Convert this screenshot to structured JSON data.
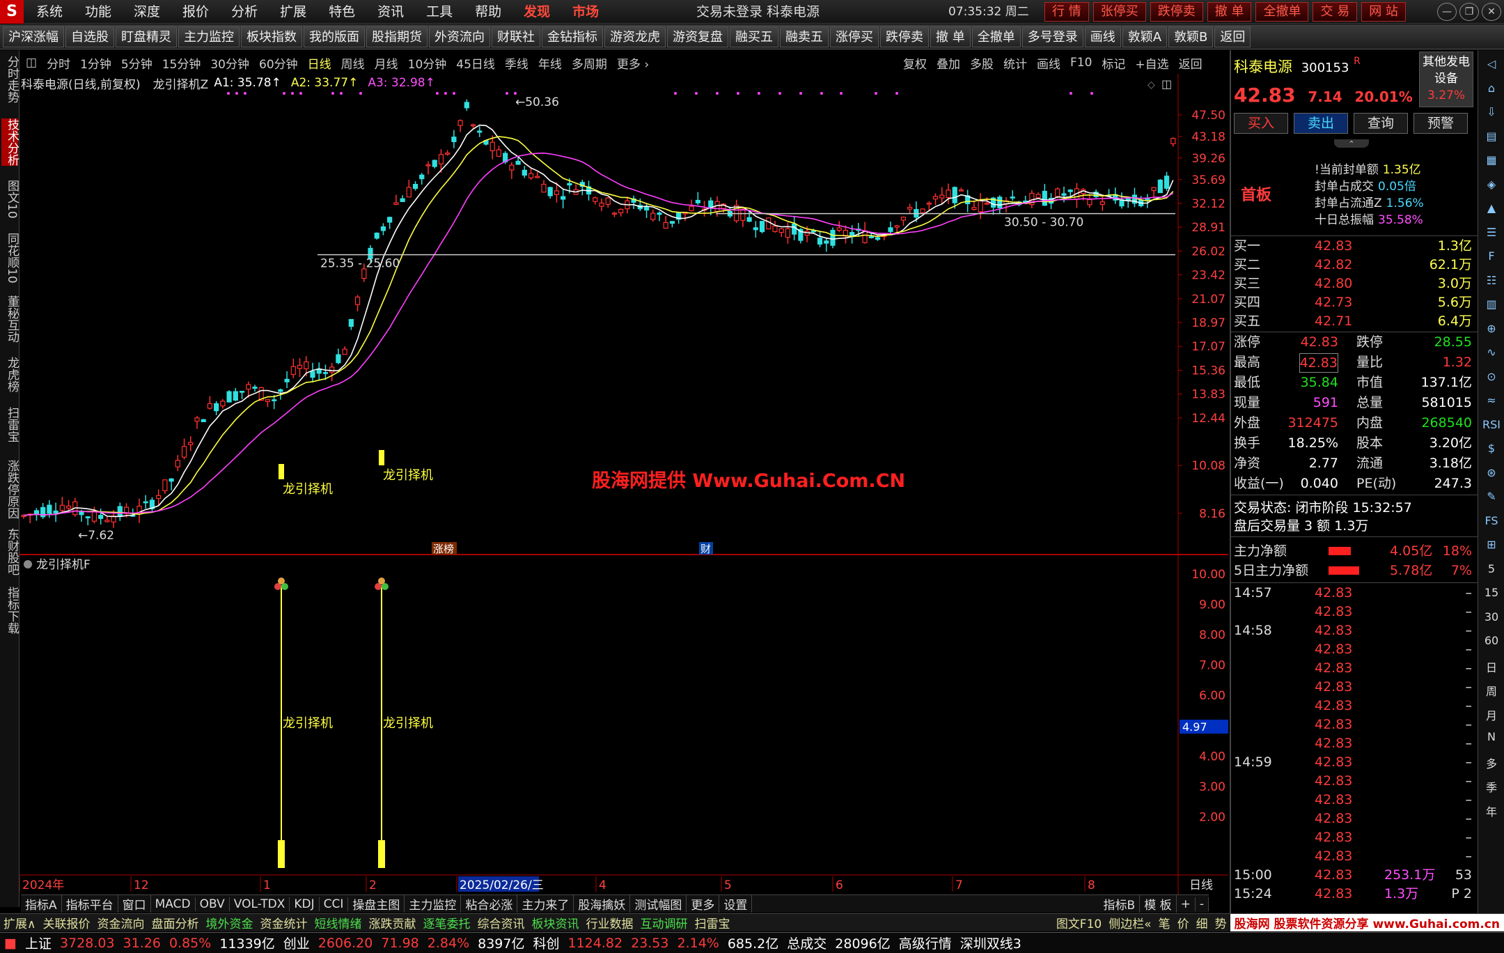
{
  "app": {
    "logo": "S",
    "menu": [
      "系统",
      "功能",
      "深度",
      "报价",
      "分析",
      "扩展",
      "特色",
      "资讯",
      "工具",
      "帮助"
    ],
    "menu_highlight": [
      "发现",
      "市场"
    ],
    "title": "交易未登录  科泰电源",
    "clock": "07:35:32 周二",
    "quick": [
      "行 情",
      "张停买",
      "跌停卖",
      "撤 单",
      "全撤单",
      "交 易",
      "网 站"
    ],
    "win": [
      "—",
      "❐",
      "✕"
    ]
  },
  "toolbar": [
    "沪深涨幅",
    "自选股",
    "盯盘精灵",
    "主力监控",
    "板块指数",
    "我的版面",
    "股指期货",
    "外资流向",
    "财联社",
    "金钻指标",
    "游资龙虎",
    "游资复盘",
    "融买五",
    "融卖五",
    "涨停买",
    "跌停卖",
    "撤 单",
    "全撤单",
    "多号登录",
    "画线",
    "敦颖A",
    "敦颖B",
    "返回"
  ],
  "left_tabs": [
    "分时走势",
    "技术分析",
    "图文10",
    "同花顺10",
    "董秘互动",
    "龙虎榜",
    "扫雷宝",
    "涨跌停原因",
    "东财股吧",
    "指标下载"
  ],
  "periods": [
    "分时",
    "1分钟",
    "5分钟",
    "15分钟",
    "30分钟",
    "60分钟",
    "日线",
    "周线",
    "月线",
    "10分钟",
    "45日线",
    "季线",
    "年线",
    "多周期",
    "更多 ›"
  ],
  "period_active": "日线",
  "chart_tools": [
    "复权",
    "叠加",
    "多股",
    "统计",
    "画线",
    "F10",
    "标记",
    "+自选",
    "返回"
  ],
  "legend": {
    "name": "科泰电源(日线,前复权)",
    "indicator": "龙引择机Z",
    "a1": "A1: 35.78↑",
    "a2": "A2: 33.77↑",
    "a3": "A3: 32.98↑"
  },
  "annotations": {
    "high": "50.36",
    "low": "7.62",
    "band1": "25.35 - 25.60",
    "band2": "30.50 - 30.70",
    "signal": "龙引择机",
    "tag_zb": "涨榜",
    "tag_cai": "财"
  },
  "price_axis": [
    "47.50",
    "43.18",
    "39.26",
    "35.69",
    "32.12",
    "28.91",
    "26.02",
    "23.42",
    "21.07",
    "18.97",
    "17.07",
    "15.36",
    "13.83",
    "12.44",
    "10.08",
    "8.16"
  ],
  "sub_legend": "龙引择机F",
  "sub_axis": [
    "10.00",
    "9.00",
    "8.00",
    "7.00",
    "6.00",
    "5.00",
    "4.00",
    "3.00",
    "2.00"
  ],
  "sub_current": "4.97",
  "date_axis": [
    "2024年",
    "12",
    "1",
    "2",
    "2025/02/26/三",
    "4",
    "5",
    "6",
    "7",
    "8"
  ],
  "date_right": "日线",
  "watermark": "股海网提供 Www.Guhai.Com.CN",
  "stock": {
    "name": "科泰电源",
    "code": "300153",
    "badge": "R",
    "price": "42.83",
    "change": "7.14",
    "pct": "20.01%",
    "other_label": "其他发电设备",
    "other_pct": "3.27%",
    "buttons": [
      "买入",
      "卖出",
      "查询",
      "预警"
    ],
    "board": "首板",
    "seal": [
      {
        "k": "!当前封单额",
        "v": "1.35亿"
      },
      {
        "k": "封单占成交",
        "v": "0.05倍"
      },
      {
        "k": "封单占流通Z",
        "v": "1.56%"
      },
      {
        "k": "十日总振幅",
        "v": "35.58%"
      }
    ],
    "bids": [
      {
        "k": "买一",
        "p": "42.83",
        "v": "1.3亿"
      },
      {
        "k": "买二",
        "p": "42.82",
        "v": "62.1万"
      },
      {
        "k": "买三",
        "p": "42.80",
        "v": "3.0万"
      },
      {
        "k": "买四",
        "p": "42.73",
        "v": "5.6万"
      },
      {
        "k": "买五",
        "p": "42.71",
        "v": "6.4万"
      }
    ],
    "stats": [
      {
        "k1": "涨停",
        "v1": "42.83",
        "k2": "跌停",
        "v2": "28.55"
      },
      {
        "k1": "最高",
        "v1": "42.83",
        "k2": "量比",
        "v2": "1.32"
      },
      {
        "k1": "最低",
        "v1": "35.84",
        "k2": "市值",
        "v2": "137.1亿"
      },
      {
        "k1": "现量",
        "v1": "591",
        "k2": "总量",
        "v2": "581015"
      },
      {
        "k1": "外盘",
        "v1": "312475",
        "k2": "内盘",
        "v2": "268540"
      },
      {
        "k1": "换手",
        "v1": "18.25%",
        "k2": "股本",
        "v2": "3.20亿"
      },
      {
        "k1": "净资",
        "v1": "2.77",
        "k2": "流通",
        "v2": "3.18亿"
      },
      {
        "k1": "收益(一)",
        "v1": "0.040",
        "k2": "PE(动)",
        "v2": "247.3"
      }
    ],
    "trade_state": "交易状态: 闭市阶段 15:32:57",
    "after_trade": "盘后交易量 3 额 1.3万",
    "net1_label": "主力净额",
    "net1_val": "4.05亿",
    "net1_pct": "18%",
    "net2_label": "5日主力净额",
    "net2_val": "5.78亿",
    "net2_pct": "7%",
    "ticks": [
      {
        "t": "14:57",
        "p": "42.83",
        "v": "",
        "d": "–"
      },
      {
        "t": "",
        "p": "42.83",
        "v": "",
        "d": "–"
      },
      {
        "t": "14:58",
        "p": "42.83",
        "v": "",
        "d": "–"
      },
      {
        "t": "",
        "p": "42.83",
        "v": "",
        "d": "–"
      },
      {
        "t": "",
        "p": "42.83",
        "v": "",
        "d": "–"
      },
      {
        "t": "",
        "p": "42.83",
        "v": "",
        "d": "–"
      },
      {
        "t": "",
        "p": "42.83",
        "v": "",
        "d": "–"
      },
      {
        "t": "",
        "p": "42.83",
        "v": "",
        "d": "–"
      },
      {
        "t": "",
        "p": "42.83",
        "v": "",
        "d": "–"
      },
      {
        "t": "14:59",
        "p": "42.83",
        "v": "",
        "d": "–"
      },
      {
        "t": "",
        "p": "42.83",
        "v": "",
        "d": "–"
      },
      {
        "t": "",
        "p": "42.83",
        "v": "",
        "d": "–"
      },
      {
        "t": "",
        "p": "42.83",
        "v": "",
        "d": "–"
      },
      {
        "t": "",
        "p": "42.83",
        "v": "",
        "d": "–"
      },
      {
        "t": "",
        "p": "42.83",
        "v": "",
        "d": "–"
      },
      {
        "t": "15:00",
        "p": "42.83",
        "v": "253.1万",
        "d": "53"
      },
      {
        "t": "15:24",
        "p": "42.83",
        "v": "1.3万",
        "d": "P  2"
      }
    ]
  },
  "right_icons": [
    "◁",
    "⌂",
    "⇩",
    "▤",
    "▦",
    "◈",
    "▲",
    "☰",
    "F",
    "☷",
    "▥",
    "⊕",
    "∿",
    "⊙",
    "≈",
    "RSI",
    "$",
    "⊛",
    "✎",
    "FS",
    "⊞",
    "5",
    "15",
    "30",
    "60",
    "日",
    "周",
    "月",
    "N",
    "多",
    "季",
    "年"
  ],
  "indicator_tabs": [
    "指标A",
    "指标平台",
    "窗口",
    "MACD",
    "OBV",
    "VOL-TDX",
    "KDJ",
    "CCI",
    "操盘主图",
    "主力监控",
    "粘合必涨",
    "主力来了",
    "股海擒妖",
    "测试幅图",
    "更多",
    "设置"
  ],
  "indicator_right": [
    "指标B",
    "模 板",
    "+",
    "-"
  ],
  "ext_tabs": [
    "扩展∧",
    "关联报价",
    "资金流向",
    "盘面分析",
    "境外资金",
    "资金统计",
    "短线情绪",
    "涨跌贡献",
    "逐笔委托",
    "综合资讯",
    "板块资讯",
    "行业数据",
    "互动调研",
    "扫雷宝"
  ],
  "ext_right": [
    "图文F10",
    "侧边栏«",
    "笔",
    "价",
    "细",
    "势",
    "股海网 股票软件资源分享 www.Guhai.com.cn"
  ],
  "status": [
    {
      "t": "上证",
      "c": "white"
    },
    {
      "t": "3728.03",
      "c": "red"
    },
    {
      "t": "31.26",
      "c": "red"
    },
    {
      "t": "0.85%",
      "c": "red"
    },
    {
      "t": "11339亿",
      "c": "white"
    },
    {
      "t": "创业",
      "c": "white"
    },
    {
      "t": "2606.20",
      "c": "red"
    },
    {
      "t": "71.98",
      "c": "red"
    },
    {
      "t": "2.84%",
      "c": "red"
    },
    {
      "t": "8397亿",
      "c": "white"
    },
    {
      "t": "科创",
      "c": "white"
    },
    {
      "t": "1124.82",
      "c": "red"
    },
    {
      "t": "23.53",
      "c": "red"
    },
    {
      "t": "2.14%",
      "c": "red"
    },
    {
      "t": "685.2亿",
      "c": "white"
    },
    {
      "t": "总成交",
      "c": "white"
    },
    {
      "t": "28096亿",
      "c": "white"
    },
    {
      "t": "高级行情",
      "c": "white"
    },
    {
      "t": "深圳双线3",
      "c": "white"
    }
  ]
}
